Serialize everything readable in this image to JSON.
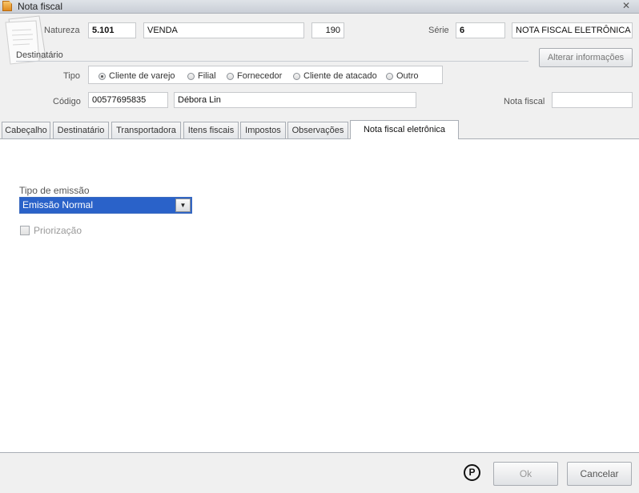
{
  "window": {
    "title": "Nota fiscal",
    "close_glyph": "✕"
  },
  "header": {
    "natureza": {
      "label": "Natureza",
      "code": "5.101",
      "description": "VENDA",
      "number": "190"
    },
    "serie": {
      "label": "Série",
      "number": "6",
      "description": "NOTA FISCAL ELETRÔNICA"
    },
    "destinatario_title": "Destinatário",
    "alterar_button": "Alterar informações",
    "tipo": {
      "label": "Tipo",
      "options": [
        "Cliente de varejo",
        "Filial",
        "Fornecedor",
        "Cliente de atacado",
        "Outro"
      ],
      "selected": "Cliente de varejo"
    },
    "codigo": {
      "label": "Código",
      "value": "00577695835",
      "name": "Débora Lin"
    },
    "nota_fiscal": {
      "label": "Nota fiscal",
      "value": ""
    }
  },
  "tabs": [
    {
      "label": "Cabeçalho",
      "active": false
    },
    {
      "label": "Destinatário",
      "active": false
    },
    {
      "label": "Transportadora",
      "active": false
    },
    {
      "label": "Itens fiscais",
      "active": false
    },
    {
      "label": "Impostos",
      "active": false
    },
    {
      "label": "Observações",
      "active": false
    },
    {
      "label": "Nota fiscal eletrônica",
      "active": true
    }
  ],
  "content": {
    "tipo_emissao_label": "Tipo de emissão",
    "tipo_emissao_value": "Emissão Normal",
    "priorizacao_label": "Priorização",
    "priorizacao_checked": false
  },
  "footer": {
    "badge": "P",
    "ok_label": "Ok",
    "cancel_label": "Cancelar"
  },
  "colors": {
    "selection": "#2a62c9",
    "panel_bg": "#ffffff",
    "window_bg": "#f0f0f0"
  }
}
